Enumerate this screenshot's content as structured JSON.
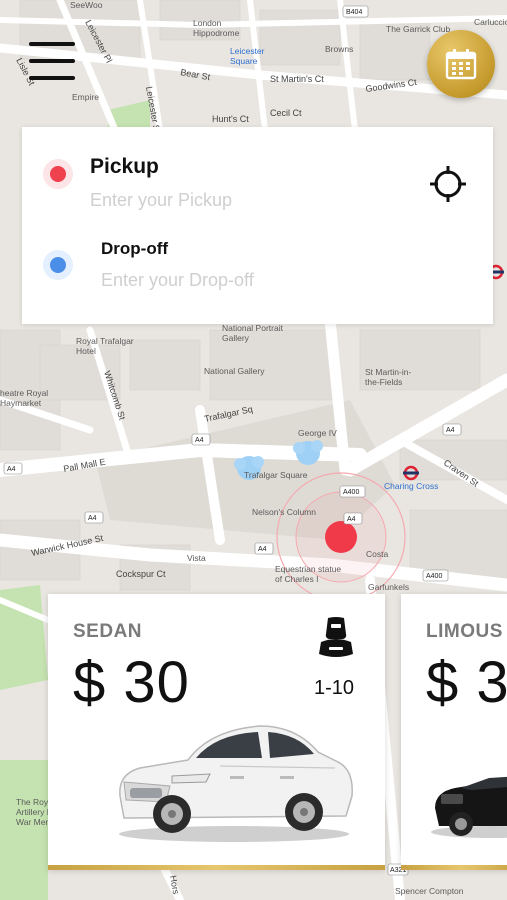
{
  "header": {
    "menu_icon": "hamburger-menu-icon",
    "schedule_icon": "calendar-icon",
    "accent_color": "#d4ad49"
  },
  "route": {
    "pickup": {
      "label": "Pickup",
      "placeholder": "Enter your Pickup",
      "dot_color": "#f0414e"
    },
    "dropoff": {
      "label": "Drop-off",
      "placeholder": "Enter your Drop-off",
      "dot_color": "#4a8ee8"
    },
    "locate_icon": "crosshair-icon"
  },
  "map": {
    "labels": {
      "seewoo": "SeeWoo",
      "london_hippodrome": "London\nHippodrome",
      "leicester_square": "Leicester\nSquare",
      "browns": "Browns",
      "garrick_club": "The Garrick Club",
      "carluccio": "Carluccio",
      "b404": "B404",
      "leicester_pl": "Leicester Pl",
      "lisle_st": "Lisle St",
      "leicester_st": "Leicester St",
      "bear_st": "Bear St",
      "st_martins_ct": "St Martin's Ct",
      "goodwins_ct": "Goodwins Ct",
      "empire": "Empire",
      "hunts_ct": "Hunt's Ct",
      "cecil_ct": "Cecil Ct",
      "national_portrait_gallery": "National Portrait\nGallery",
      "royal_trafalgar_hotel": "Royal Trafalgar\nHotel",
      "national_gallery": "National Gallery",
      "st_martin_in_the_fields": "St Martin-in-\nthe-Fields",
      "theatre_royal_haymarket": "heatre Royal\nHaymarket",
      "whitcomb_st": "Whitcomb St",
      "trafalgar_sq_road": "Trafalgar Sq",
      "george_iv": "George IV",
      "trafalgar_square": "Trafalgar Square",
      "nelsons_column": "Nelson's Column",
      "charing_cross": "Charing Cross",
      "craven_st": "Craven St",
      "pall_mall_e": "Pall Mall E",
      "warwick_house_st": "Warwick House St",
      "cockspur_ct": "Cockspur Ct",
      "vista": "Vista",
      "costa": "Costa",
      "equestrian_statue": "Equestrian statue\nof Charles I",
      "garfunkels": "Garfunkels",
      "royal_artillery": "The Roy\nArtillery B\nWar Memo",
      "spencer_compton": "Spencer Compton",
      "horse": "Hors",
      "a4": "A4",
      "a400": "A400",
      "a3212": "A321"
    },
    "current_location_color": "#f03a4a"
  },
  "vehicles": [
    {
      "type": "SEDAN",
      "price": "$ 30",
      "capacity": "1-10",
      "seat_icon": "car-seat-icon"
    },
    {
      "type": "LIMOUS",
      "price": "$ 3"
    }
  ]
}
